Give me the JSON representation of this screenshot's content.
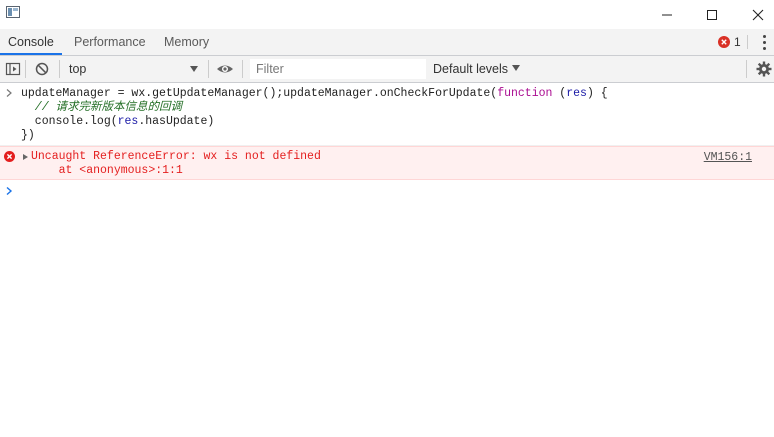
{
  "window": {
    "app_icon": "devtools-window-icon",
    "controls": [
      "minimize-icon",
      "maximize-icon",
      "close-icon"
    ]
  },
  "tabs": [
    {
      "label": "Console",
      "active": true
    },
    {
      "label": "Performance",
      "active": false
    },
    {
      "label": "Memory",
      "active": false
    }
  ],
  "error_counter": {
    "icon": "error-circle-icon",
    "count": "1"
  },
  "toolbar": {
    "context": "top",
    "filter_placeholder": "Filter",
    "levels_label": "Default levels",
    "icons": [
      "sidebar-toggle-icon",
      "clear-console-icon",
      "eye-icon",
      "gear-icon",
      "kebab-menu-icon"
    ]
  },
  "console": {
    "input": {
      "line1_a": "updateManager = wx.getUpdateManager();updateManager.onCheckForUpdate(",
      "line1_kw": "function",
      "line1_b": " (",
      "line1_param": "res",
      "line1_c": ") {",
      "line2": "  // 请求完新版本信息的回调",
      "line3_a": "  console.log(",
      "line3_param": "res",
      "line3_b": ".hasUpdate)",
      "line4": "})"
    },
    "error": {
      "message": "Uncaught ReferenceError: wx is not defined",
      "stack": "    at <anonymous>:1:1",
      "source": "VM156:1"
    }
  },
  "colors": {
    "accent": "#1a73e8",
    "error_red": "#e41e1e",
    "error_bg": "#fff0f0",
    "keyword": "#aa0d91",
    "comment": "#236e25"
  }
}
